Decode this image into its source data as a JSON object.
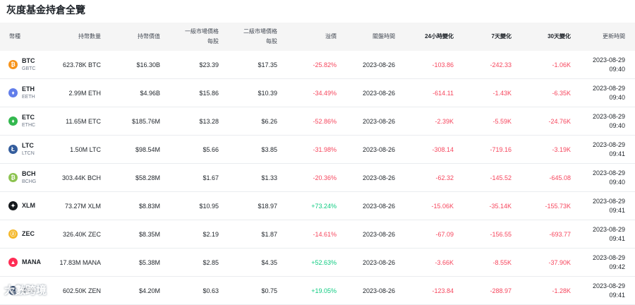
{
  "title": "灰度基金持倉全覽",
  "headers": {
    "coin": "幣種",
    "holdings": "持幣數量",
    "value": "持幣價值",
    "primary_line1": "一級市場價格",
    "primary_line2": "每股",
    "secondary_line1": "二級市場價格",
    "secondary_line2": "每股",
    "premium": "溢價",
    "close_time": "關盤時間",
    "change_24h": "24小時變化",
    "change_7d": "7天變化",
    "change_30d": "30天變化",
    "updated": "更新時間"
  },
  "rows": [
    {
      "symbol": "BTC",
      "fund": "GBTC",
      "icon": "bitcoin-icon",
      "color": "#f7931a",
      "glyph": "₿",
      "holdings": "623.78K BTC",
      "value": "$16.30B",
      "primary": "$23.39",
      "secondary": "$17.35",
      "premium": "-25.82%",
      "close": "2023-08-26",
      "c24": "-103.86",
      "c7": "-242.33",
      "c30": "-1.06K",
      "date": "2023-08-29",
      "time": "09:40"
    },
    {
      "symbol": "ETH",
      "fund": "EETH",
      "icon": "ethereum-icon",
      "color": "#627eea",
      "glyph": "♦",
      "holdings": "2.99M ETH",
      "value": "$4.96B",
      "primary": "$15.86",
      "secondary": "$10.39",
      "premium": "-34.49%",
      "close": "2023-08-26",
      "c24": "-614.11",
      "c7": "-1.43K",
      "c30": "-6.35K",
      "date": "2023-08-29",
      "time": "09:40"
    },
    {
      "symbol": "ETC",
      "fund": "ETHC",
      "icon": "ethereum-classic-icon",
      "color": "#33b84f",
      "glyph": "♦",
      "holdings": "11.65M ETC",
      "value": "$185.76M",
      "primary": "$13.28",
      "secondary": "$6.26",
      "premium": "-52.86%",
      "close": "2023-08-26",
      "c24": "-2.39K",
      "c7": "-5.59K",
      "c30": "-24.76K",
      "date": "2023-08-29",
      "time": "09:40"
    },
    {
      "symbol": "LTC",
      "fund": "LTCN",
      "icon": "litecoin-icon",
      "color": "#345d9d",
      "glyph": "Ł",
      "holdings": "1.50M LTC",
      "value": "$98.54M",
      "primary": "$5.66",
      "secondary": "$3.85",
      "premium": "-31.98%",
      "close": "2023-08-26",
      "c24": "-308.14",
      "c7": "-719.16",
      "c30": "-3.19K",
      "date": "2023-08-29",
      "time": "09:41"
    },
    {
      "symbol": "BCH",
      "fund": "BCHG",
      "icon": "bitcoin-cash-icon",
      "color": "#8dc351",
      "glyph": "₿",
      "holdings": "303.44K BCH",
      "value": "$58.28M",
      "primary": "$1.67",
      "secondary": "$1.33",
      "premium": "-20.36%",
      "close": "2023-08-26",
      "c24": "-62.32",
      "c7": "-145.52",
      "c30": "-645.08",
      "date": "2023-08-29",
      "time": "09:40"
    },
    {
      "symbol": "XLM",
      "fund": "",
      "icon": "stellar-icon",
      "color": "#14181c",
      "glyph": "✦",
      "holdings": "73.27M XLM",
      "value": "$8.83M",
      "primary": "$10.95",
      "secondary": "$18.97",
      "premium": "+73.24%",
      "close": "2023-08-26",
      "c24": "-15.06K",
      "c7": "-35.14K",
      "c30": "-155.73K",
      "date": "2023-08-29",
      "time": "09:41"
    },
    {
      "symbol": "ZEC",
      "fund": "",
      "icon": "zcash-icon",
      "color": "#f4b728",
      "glyph": "ⓩ",
      "holdings": "326.40K ZEC",
      "value": "$8.35M",
      "primary": "$2.19",
      "secondary": "$1.87",
      "premium": "-14.61%",
      "close": "2023-08-26",
      "c24": "-67.09",
      "c7": "-156.55",
      "c30": "-693.77",
      "date": "2023-08-29",
      "time": "09:41"
    },
    {
      "symbol": "MANA",
      "fund": "",
      "icon": "decentraland-icon",
      "color": "#ff2d55",
      "glyph": "▲",
      "holdings": "17.83M MANA",
      "value": "$5.38M",
      "primary": "$2.85",
      "secondary": "$4.35",
      "premium": "+52.63%",
      "close": "2023-08-26",
      "c24": "-3.66K",
      "c7": "-8.55K",
      "c30": "-37.90K",
      "date": "2023-08-29",
      "time": "09:42"
    },
    {
      "symbol": "ZEN",
      "fund": "",
      "icon": "horizen-icon",
      "color": "#23395d",
      "glyph": "Z",
      "holdings": "602.50K ZEN",
      "value": "$4.20M",
      "primary": "$0.63",
      "secondary": "$0.75",
      "premium": "+19.05%",
      "close": "2023-08-26",
      "c24": "-123.84",
      "c7": "-288.97",
      "c30": "-1.28K",
      "date": "2023-08-29",
      "time": "09:41"
    }
  ],
  "watermark": "大數跨境"
}
